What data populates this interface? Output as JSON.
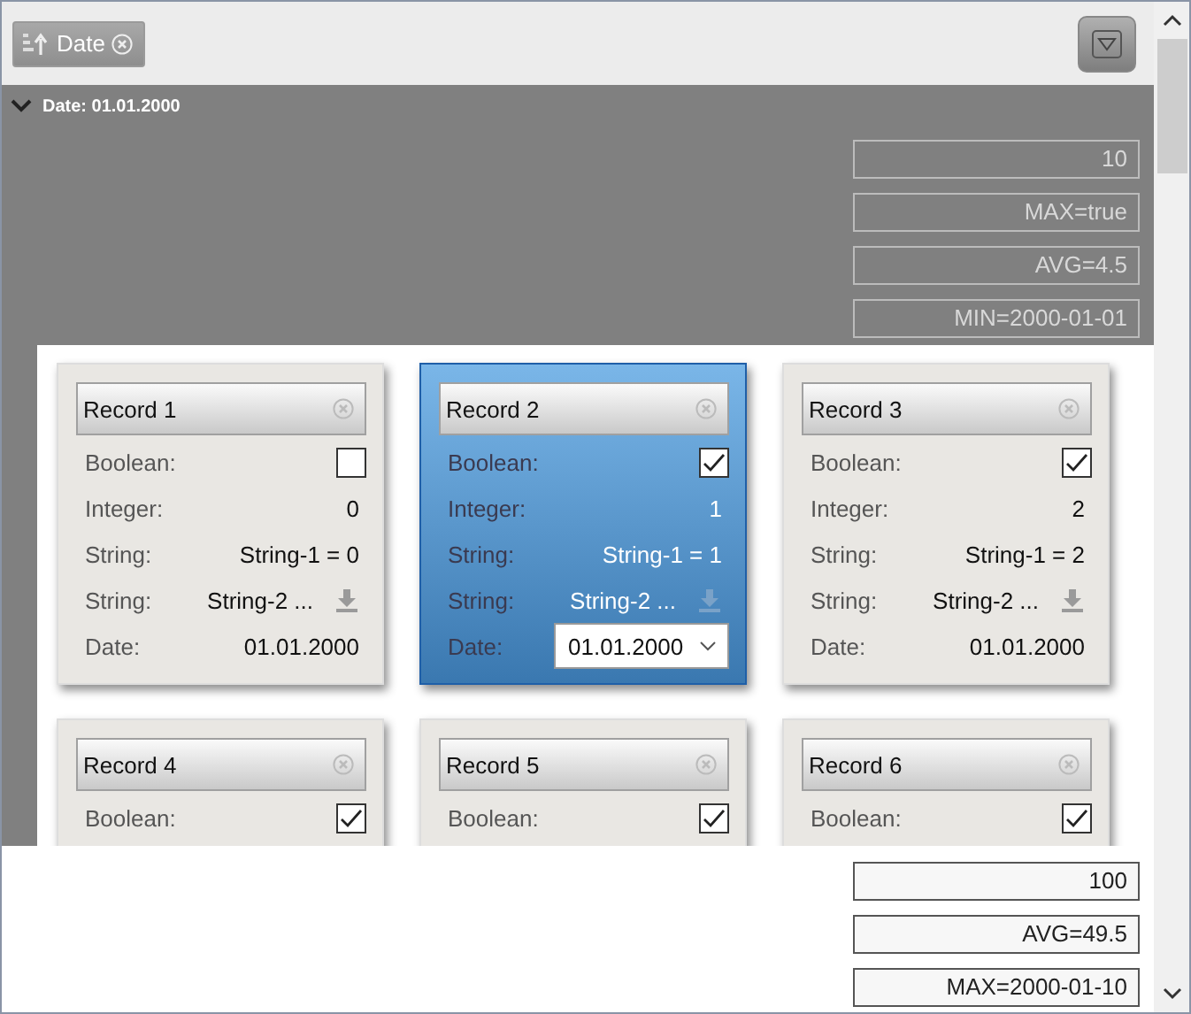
{
  "toolbar": {
    "sort_chip": {
      "label": "Date"
    }
  },
  "group": {
    "header": "Date: 01.01.2000",
    "expanded": true,
    "summaries": [
      "10",
      "MAX=true",
      "AVG=4.5",
      "MIN=2000-01-01"
    ]
  },
  "records": [
    {
      "title": "Record 1",
      "selected": false,
      "fields": [
        {
          "kind": "checkbox",
          "label": "Boolean:",
          "checked": false
        },
        {
          "kind": "text",
          "label": "Integer:",
          "value": "0"
        },
        {
          "kind": "text",
          "label": "String:",
          "value": "String-1 = 0"
        },
        {
          "kind": "download",
          "label": "String:",
          "value": "String-2 ..."
        },
        {
          "kind": "date",
          "label": "Date:",
          "value": "01.01.2000"
        }
      ]
    },
    {
      "title": "Record 2",
      "selected": true,
      "fields": [
        {
          "kind": "checkbox",
          "label": "Boolean:",
          "checked": true
        },
        {
          "kind": "text",
          "label": "Integer:",
          "value": "1"
        },
        {
          "kind": "text",
          "label": "String:",
          "value": "String-1 = 1"
        },
        {
          "kind": "download",
          "label": "String:",
          "value": "String-2 ..."
        },
        {
          "kind": "date",
          "label": "Date:",
          "value": "01.01.2000"
        }
      ]
    },
    {
      "title": "Record 3",
      "selected": false,
      "fields": [
        {
          "kind": "checkbox",
          "label": "Boolean:",
          "checked": true
        },
        {
          "kind": "text",
          "label": "Integer:",
          "value": "2"
        },
        {
          "kind": "text",
          "label": "String:",
          "value": "String-1 = 2"
        },
        {
          "kind": "download",
          "label": "String:",
          "value": "String-2 ..."
        },
        {
          "kind": "date",
          "label": "Date:",
          "value": "01.01.2000"
        }
      ]
    },
    {
      "title": "Record 4",
      "selected": false,
      "fields": [
        {
          "kind": "checkbox",
          "label": "Boolean:",
          "checked": true
        }
      ]
    },
    {
      "title": "Record 5",
      "selected": false,
      "fields": [
        {
          "kind": "checkbox",
          "label": "Boolean:",
          "checked": true
        }
      ]
    },
    {
      "title": "Record 6",
      "selected": false,
      "fields": [
        {
          "kind": "checkbox",
          "label": "Boolean:",
          "checked": true
        }
      ]
    }
  ],
  "totals": [
    "100",
    "AVG=49.5",
    "MAX=2000-01-10"
  ]
}
